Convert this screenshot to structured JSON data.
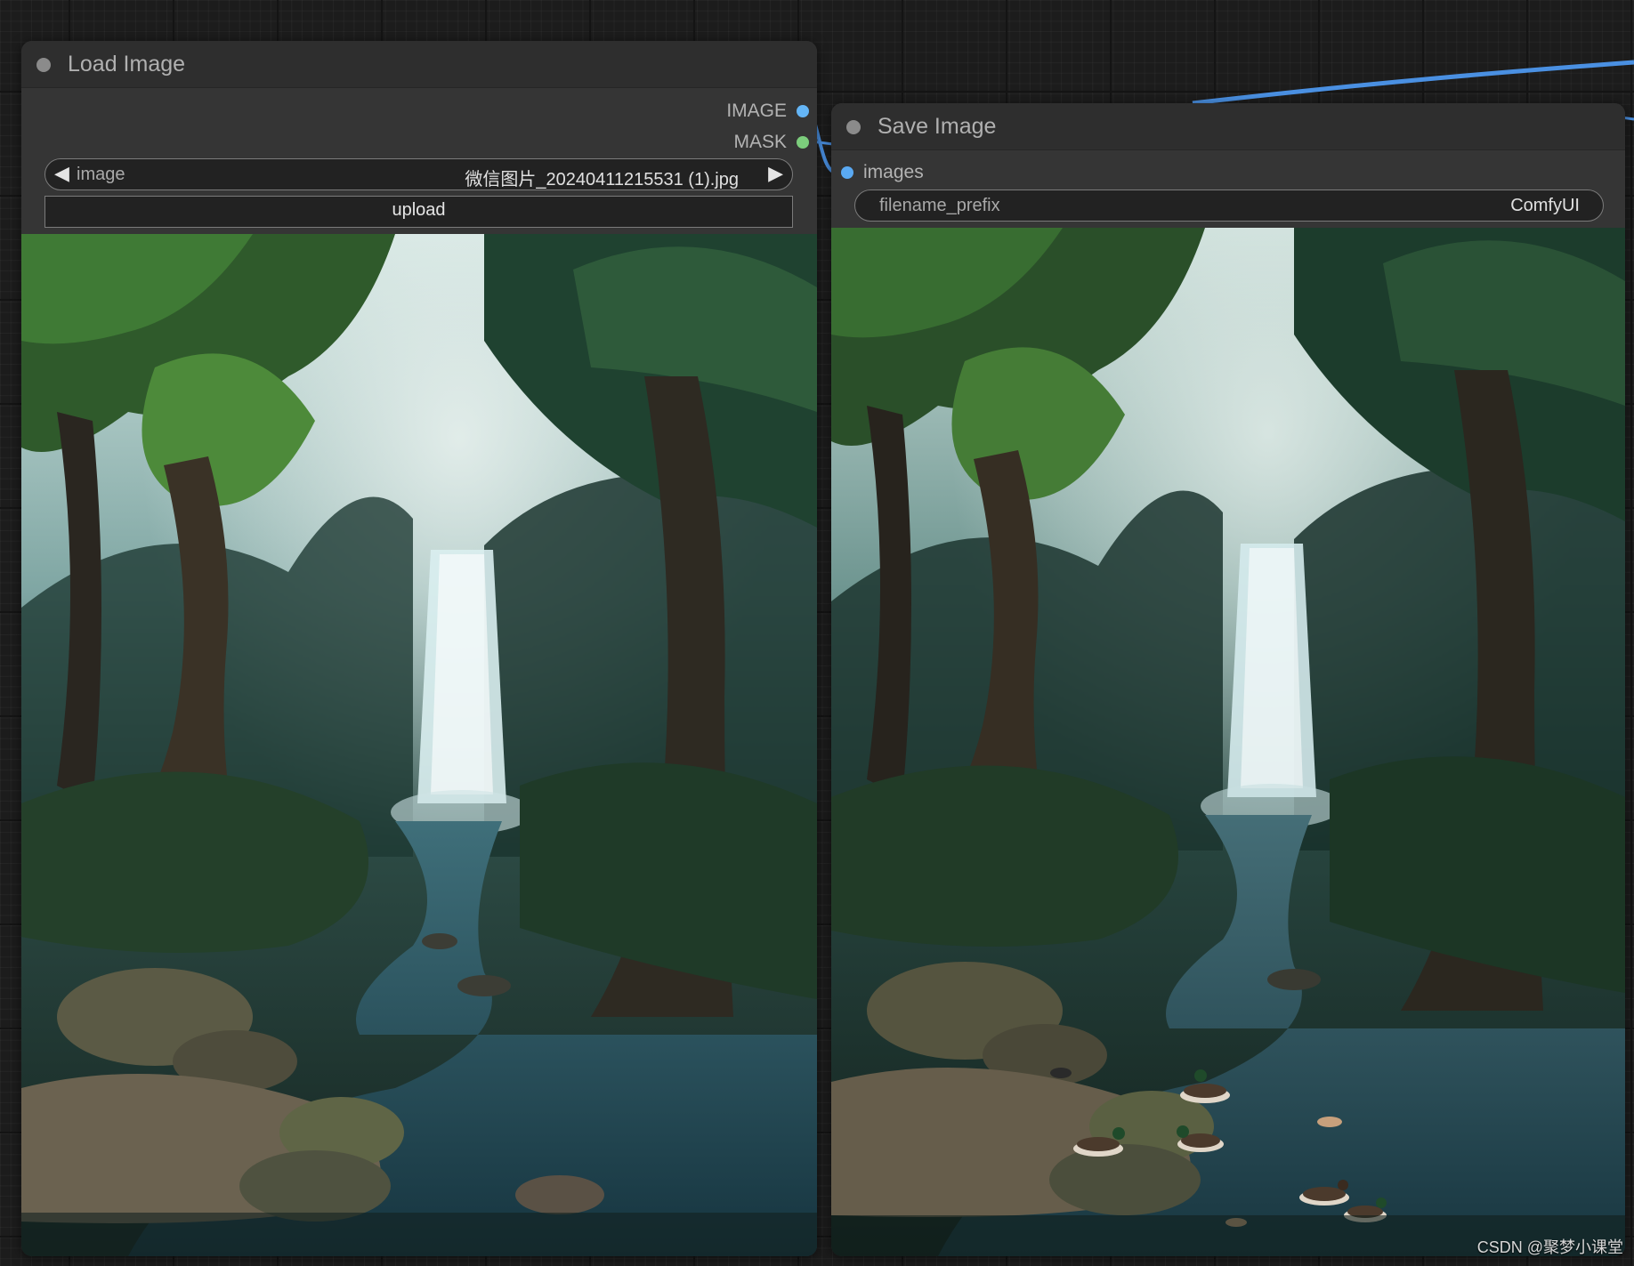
{
  "load_node": {
    "title": "Load Image",
    "outputs": [
      {
        "label": "IMAGE",
        "color": "#64b5f6"
      },
      {
        "label": "MASK",
        "color": "#7ccd7c"
      }
    ],
    "image_widget": {
      "name": "image",
      "value": "微信图片_20240411215531 (1).jpg"
    },
    "upload_label": "upload",
    "preview": {
      "subject": "forest waterfall with stream"
    }
  },
  "save_node": {
    "title": "Save Image",
    "inputs": [
      {
        "label": "images",
        "color": "#5aa9f2"
      }
    ],
    "prefix_widget": {
      "name": "filename_prefix",
      "value": "ComfyUI"
    },
    "preview": {
      "subject": "forest waterfall with stream and ducks"
    }
  },
  "link_color": "#4a90e2",
  "watermark": "CSDN @聚梦小课堂"
}
